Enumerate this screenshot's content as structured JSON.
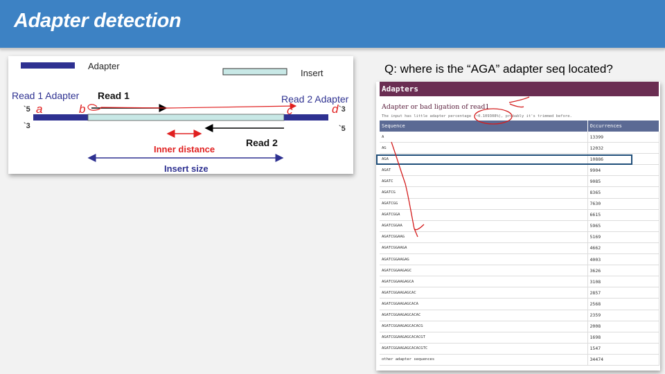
{
  "slide": {
    "title": "Adapter detection",
    "colors": {
      "banner": "#3d82c4",
      "adapter_bar": "#2e3191",
      "insert_bar": "#c8e8e6",
      "red_label": "#e02020",
      "highlight_box": "#1f4e79"
    }
  },
  "diagram": {
    "legend_adapter": "Adapter",
    "legend_insert": "Insert",
    "read1_adapter": "Read 1 Adapter",
    "read1": "Read 1",
    "read2_adapter": "Read 2 Adapter",
    "read2": "Read 2",
    "end5_left": "`5",
    "end3_left": "`3",
    "end3_right": "`3",
    "end5_right": "`5",
    "mark_a": "a",
    "mark_b": "b",
    "mark_c": "c",
    "mark_d": "d",
    "inner_distance": "Inner distance",
    "insert_size": "Insert size"
  },
  "question": "Q: where is the “AGA” adapter seq located?",
  "report": {
    "section_title": "Adapters",
    "subtitle": "Adapter or bad ligation of read1",
    "note": "The input has little adapter percentage (~0.109308%), probably it's trimmed before.",
    "columns": [
      "Sequence",
      "Occurrences"
    ],
    "rows": [
      {
        "sequence": "A",
        "occurrences": "13399"
      },
      {
        "sequence": "AG",
        "occurrences": "12032"
      },
      {
        "sequence": "AGA",
        "occurrences": "10886"
      },
      {
        "sequence": "AGAT",
        "occurrences": "9904"
      },
      {
        "sequence": "AGATC",
        "occurrences": "9085"
      },
      {
        "sequence": "AGATCG",
        "occurrences": "8365"
      },
      {
        "sequence": "AGATCGG",
        "occurrences": "7630"
      },
      {
        "sequence": "AGATCGGA",
        "occurrences": "6615"
      },
      {
        "sequence": "AGATCGGAA",
        "occurrences": "5965"
      },
      {
        "sequence": "AGATCGGAAG",
        "occurrences": "5169"
      },
      {
        "sequence": "AGATCGGAAGA",
        "occurrences": "4662"
      },
      {
        "sequence": "AGATCGGAAGAG",
        "occurrences": "4003"
      },
      {
        "sequence": "AGATCGGAAGAGC",
        "occurrences": "3626"
      },
      {
        "sequence": "AGATCGGAAGAGCA",
        "occurrences": "3108"
      },
      {
        "sequence": "AGATCGGAAGAGCAC",
        "occurrences": "2857"
      },
      {
        "sequence": "AGATCGGAAGAGCACA",
        "occurrences": "2568"
      },
      {
        "sequence": "AGATCGGAAGAGCACAC",
        "occurrences": "2359"
      },
      {
        "sequence": "AGATCGGAAGAGCACACG",
        "occurrences": "2008"
      },
      {
        "sequence": "AGATCGGAAGAGCACACGT",
        "occurrences": "1698"
      },
      {
        "sequence": "AGATCGGAAGAGCACACGTC",
        "occurrences": "1547"
      },
      {
        "sequence": "other adapter sequences",
        "occurrences": "34474"
      }
    ]
  }
}
